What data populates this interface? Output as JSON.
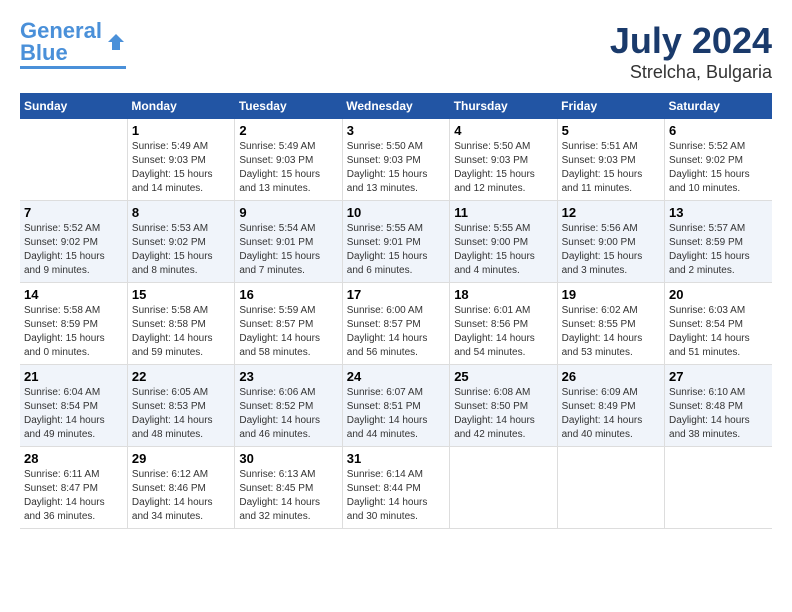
{
  "logo": {
    "line1": "General",
    "line2": "Blue"
  },
  "title": "July 2024",
  "subtitle": "Strelcha, Bulgaria",
  "headers": [
    "Sunday",
    "Monday",
    "Tuesday",
    "Wednesday",
    "Thursday",
    "Friday",
    "Saturday"
  ],
  "weeks": [
    [
      {
        "num": "",
        "info": ""
      },
      {
        "num": "1",
        "info": "Sunrise: 5:49 AM\nSunset: 9:03 PM\nDaylight: 15 hours\nand 14 minutes."
      },
      {
        "num": "2",
        "info": "Sunrise: 5:49 AM\nSunset: 9:03 PM\nDaylight: 15 hours\nand 13 minutes."
      },
      {
        "num": "3",
        "info": "Sunrise: 5:50 AM\nSunset: 9:03 PM\nDaylight: 15 hours\nand 13 minutes."
      },
      {
        "num": "4",
        "info": "Sunrise: 5:50 AM\nSunset: 9:03 PM\nDaylight: 15 hours\nand 12 minutes."
      },
      {
        "num": "5",
        "info": "Sunrise: 5:51 AM\nSunset: 9:03 PM\nDaylight: 15 hours\nand 11 minutes."
      },
      {
        "num": "6",
        "info": "Sunrise: 5:52 AM\nSunset: 9:02 PM\nDaylight: 15 hours\nand 10 minutes."
      }
    ],
    [
      {
        "num": "7",
        "info": "Sunrise: 5:52 AM\nSunset: 9:02 PM\nDaylight: 15 hours\nand 9 minutes."
      },
      {
        "num": "8",
        "info": "Sunrise: 5:53 AM\nSunset: 9:02 PM\nDaylight: 15 hours\nand 8 minutes."
      },
      {
        "num": "9",
        "info": "Sunrise: 5:54 AM\nSunset: 9:01 PM\nDaylight: 15 hours\nand 7 minutes."
      },
      {
        "num": "10",
        "info": "Sunrise: 5:55 AM\nSunset: 9:01 PM\nDaylight: 15 hours\nand 6 minutes."
      },
      {
        "num": "11",
        "info": "Sunrise: 5:55 AM\nSunset: 9:00 PM\nDaylight: 15 hours\nand 4 minutes."
      },
      {
        "num": "12",
        "info": "Sunrise: 5:56 AM\nSunset: 9:00 PM\nDaylight: 15 hours\nand 3 minutes."
      },
      {
        "num": "13",
        "info": "Sunrise: 5:57 AM\nSunset: 8:59 PM\nDaylight: 15 hours\nand 2 minutes."
      }
    ],
    [
      {
        "num": "14",
        "info": "Sunrise: 5:58 AM\nSunset: 8:59 PM\nDaylight: 15 hours\nand 0 minutes."
      },
      {
        "num": "15",
        "info": "Sunrise: 5:58 AM\nSunset: 8:58 PM\nDaylight: 14 hours\nand 59 minutes."
      },
      {
        "num": "16",
        "info": "Sunrise: 5:59 AM\nSunset: 8:57 PM\nDaylight: 14 hours\nand 58 minutes."
      },
      {
        "num": "17",
        "info": "Sunrise: 6:00 AM\nSunset: 8:57 PM\nDaylight: 14 hours\nand 56 minutes."
      },
      {
        "num": "18",
        "info": "Sunrise: 6:01 AM\nSunset: 8:56 PM\nDaylight: 14 hours\nand 54 minutes."
      },
      {
        "num": "19",
        "info": "Sunrise: 6:02 AM\nSunset: 8:55 PM\nDaylight: 14 hours\nand 53 minutes."
      },
      {
        "num": "20",
        "info": "Sunrise: 6:03 AM\nSunset: 8:54 PM\nDaylight: 14 hours\nand 51 minutes."
      }
    ],
    [
      {
        "num": "21",
        "info": "Sunrise: 6:04 AM\nSunset: 8:54 PM\nDaylight: 14 hours\nand 49 minutes."
      },
      {
        "num": "22",
        "info": "Sunrise: 6:05 AM\nSunset: 8:53 PM\nDaylight: 14 hours\nand 48 minutes."
      },
      {
        "num": "23",
        "info": "Sunrise: 6:06 AM\nSunset: 8:52 PM\nDaylight: 14 hours\nand 46 minutes."
      },
      {
        "num": "24",
        "info": "Sunrise: 6:07 AM\nSunset: 8:51 PM\nDaylight: 14 hours\nand 44 minutes."
      },
      {
        "num": "25",
        "info": "Sunrise: 6:08 AM\nSunset: 8:50 PM\nDaylight: 14 hours\nand 42 minutes."
      },
      {
        "num": "26",
        "info": "Sunrise: 6:09 AM\nSunset: 8:49 PM\nDaylight: 14 hours\nand 40 minutes."
      },
      {
        "num": "27",
        "info": "Sunrise: 6:10 AM\nSunset: 8:48 PM\nDaylight: 14 hours\nand 38 minutes."
      }
    ],
    [
      {
        "num": "28",
        "info": "Sunrise: 6:11 AM\nSunset: 8:47 PM\nDaylight: 14 hours\nand 36 minutes."
      },
      {
        "num": "29",
        "info": "Sunrise: 6:12 AM\nSunset: 8:46 PM\nDaylight: 14 hours\nand 34 minutes."
      },
      {
        "num": "30",
        "info": "Sunrise: 6:13 AM\nSunset: 8:45 PM\nDaylight: 14 hours\nand 32 minutes."
      },
      {
        "num": "31",
        "info": "Sunrise: 6:14 AM\nSunset: 8:44 PM\nDaylight: 14 hours\nand 30 minutes."
      },
      {
        "num": "",
        "info": ""
      },
      {
        "num": "",
        "info": ""
      },
      {
        "num": "",
        "info": ""
      }
    ]
  ]
}
